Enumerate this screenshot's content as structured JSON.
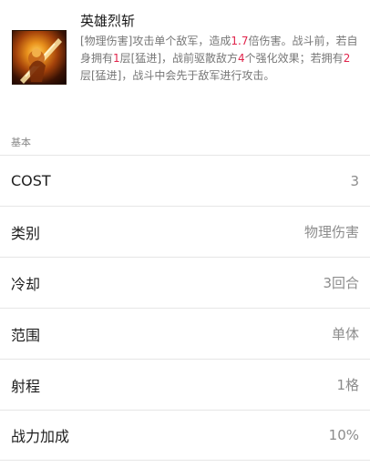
{
  "skill": {
    "icon": "hero-slash-icon",
    "name": "英雄烈斩",
    "desc": [
      {
        "t": "[物理伤害]攻击单个敌军，造成",
        "hl": false
      },
      {
        "t": "1.7",
        "hl": true
      },
      {
        "t": "倍伤害。战斗前，若自身拥有",
        "hl": false
      },
      {
        "t": "1",
        "hl": true
      },
      {
        "t": "层[猛进]，战前驱散敌方",
        "hl": false
      },
      {
        "t": "4",
        "hl": true
      },
      {
        "t": "个强化效果；若拥有",
        "hl": false
      },
      {
        "t": "2",
        "hl": true
      },
      {
        "t": "层[猛进]，战斗中会先于敌军进行攻击。",
        "hl": false
      }
    ],
    "highlight_color": "#e0244b"
  },
  "section": {
    "title": "基本"
  },
  "stats": [
    {
      "label": "COST",
      "value": "3"
    },
    {
      "label": "类别",
      "value": "物理伤害"
    },
    {
      "label": "冷却",
      "value": "3回合"
    },
    {
      "label": "范围",
      "value": "单体"
    },
    {
      "label": "射程",
      "value": "1格"
    },
    {
      "label": "战力加成",
      "value": "10%"
    }
  ]
}
